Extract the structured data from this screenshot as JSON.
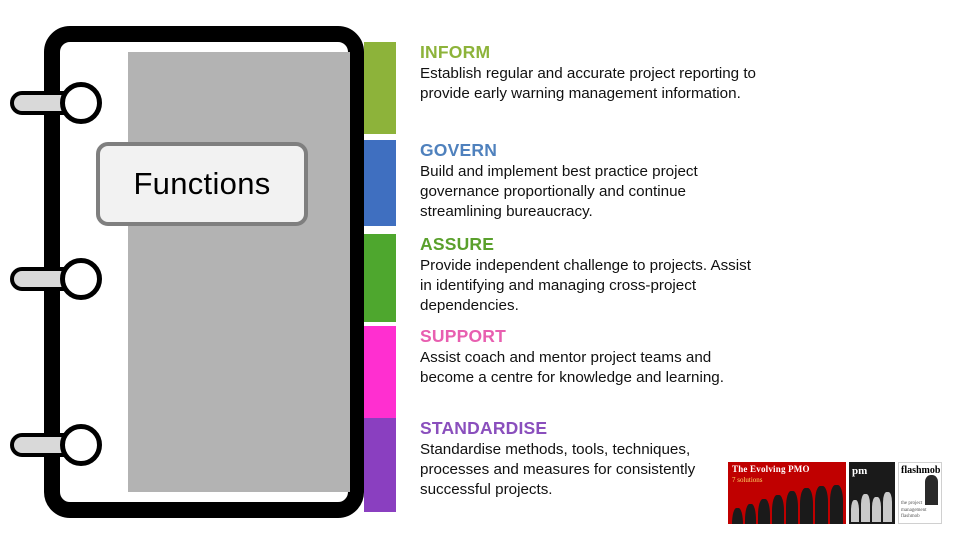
{
  "diagram": {
    "left_panel": {
      "label": "Functions",
      "page_color": "#b3b3b3",
      "frame_color": "#000000",
      "ring_count": 3
    },
    "blocks": [
      {
        "title": "INFORM",
        "title_color": "#8db33a",
        "stripe_color": "#8db33a",
        "body": "Establish regular and accurate project reporting to provide early warning management information."
      },
      {
        "title": "GOVERN",
        "title_color": "#4f81bd",
        "stripe_color": "#3f6fc0",
        "body": "Build and implement best practice project governance proportionally and continue streamlining bureaucracy."
      },
      {
        "title": "ASSURE",
        "title_color": "#5aa02c",
        "stripe_color": "#4ea72e",
        "body": "Provide independent challenge to projects. Assist in identifying and managing cross-project dependencies."
      },
      {
        "title": "SUPPORT",
        "title_color": "#e85fb0",
        "stripe_color": "#ff2fd0",
        "body": "Assist coach and mentor project teams and become a centre for knowledge and learning."
      },
      {
        "title": "STANDARDISE",
        "title_color": "#8a4fbd",
        "stripe_color": "#8a3fc0",
        "body": "Standardise methods, tools, techniques, processes and measures for consistently successful projects."
      }
    ],
    "logos": [
      {
        "name": "The Evolving PMO",
        "title": "The Evolving PMO",
        "subtitle": "7 solutions",
        "background": "#c00000"
      },
      {
        "name": "PM Logo",
        "title": "pm",
        "background": "#1a1a1a"
      },
      {
        "name": "Flashmob",
        "title": "flashmob",
        "subtitle": "the project management flashmob",
        "background": "#ffffff"
      }
    ]
  }
}
